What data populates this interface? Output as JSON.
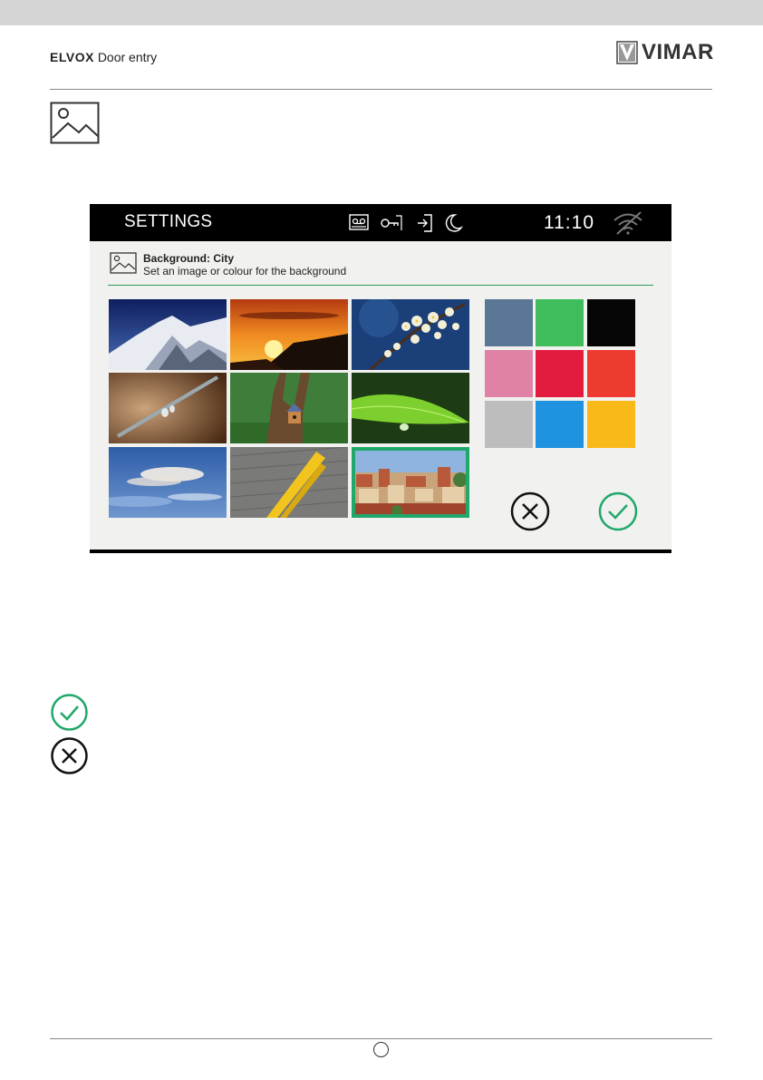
{
  "header": {
    "brand_bold": "ELVOX",
    "brand_rest": "Door entry",
    "logo_text": "VIMAR"
  },
  "screen": {
    "title": "SETTINGS",
    "clock": "11:10",
    "status_icons": [
      "voicemail-icon",
      "door-key-icon",
      "login-icon",
      "moon-icon",
      "wifi-off-icon"
    ],
    "subheading": {
      "title": "Background: City",
      "description": "Set an image or colour for the background"
    },
    "backgrounds": [
      {
        "name": "snowy-mountain",
        "selected": false
      },
      {
        "name": "sunset",
        "selected": false
      },
      {
        "name": "blossom",
        "selected": false
      },
      {
        "name": "water-drop",
        "selected": false
      },
      {
        "name": "tree-birdhouse",
        "selected": false
      },
      {
        "name": "green-leaf",
        "selected": false
      },
      {
        "name": "sky-clouds",
        "selected": false
      },
      {
        "name": "clothes-peg",
        "selected": false
      },
      {
        "name": "city",
        "selected": true
      }
    ],
    "colours": [
      "#5b7796",
      "#3fbd5b",
      "#050505",
      "#df82a6",
      "#e31b3e",
      "#ee3b30",
      "#bdbdbd",
      "#1f93e0",
      "#f9b918"
    ],
    "actions": [
      "cancel-icon",
      "confirm-icon"
    ]
  },
  "legend": [
    "confirm-icon",
    "cancel-icon"
  ],
  "colors": {
    "accent_green": "#20a86a",
    "topbar_grey": "#d5d5d5"
  }
}
